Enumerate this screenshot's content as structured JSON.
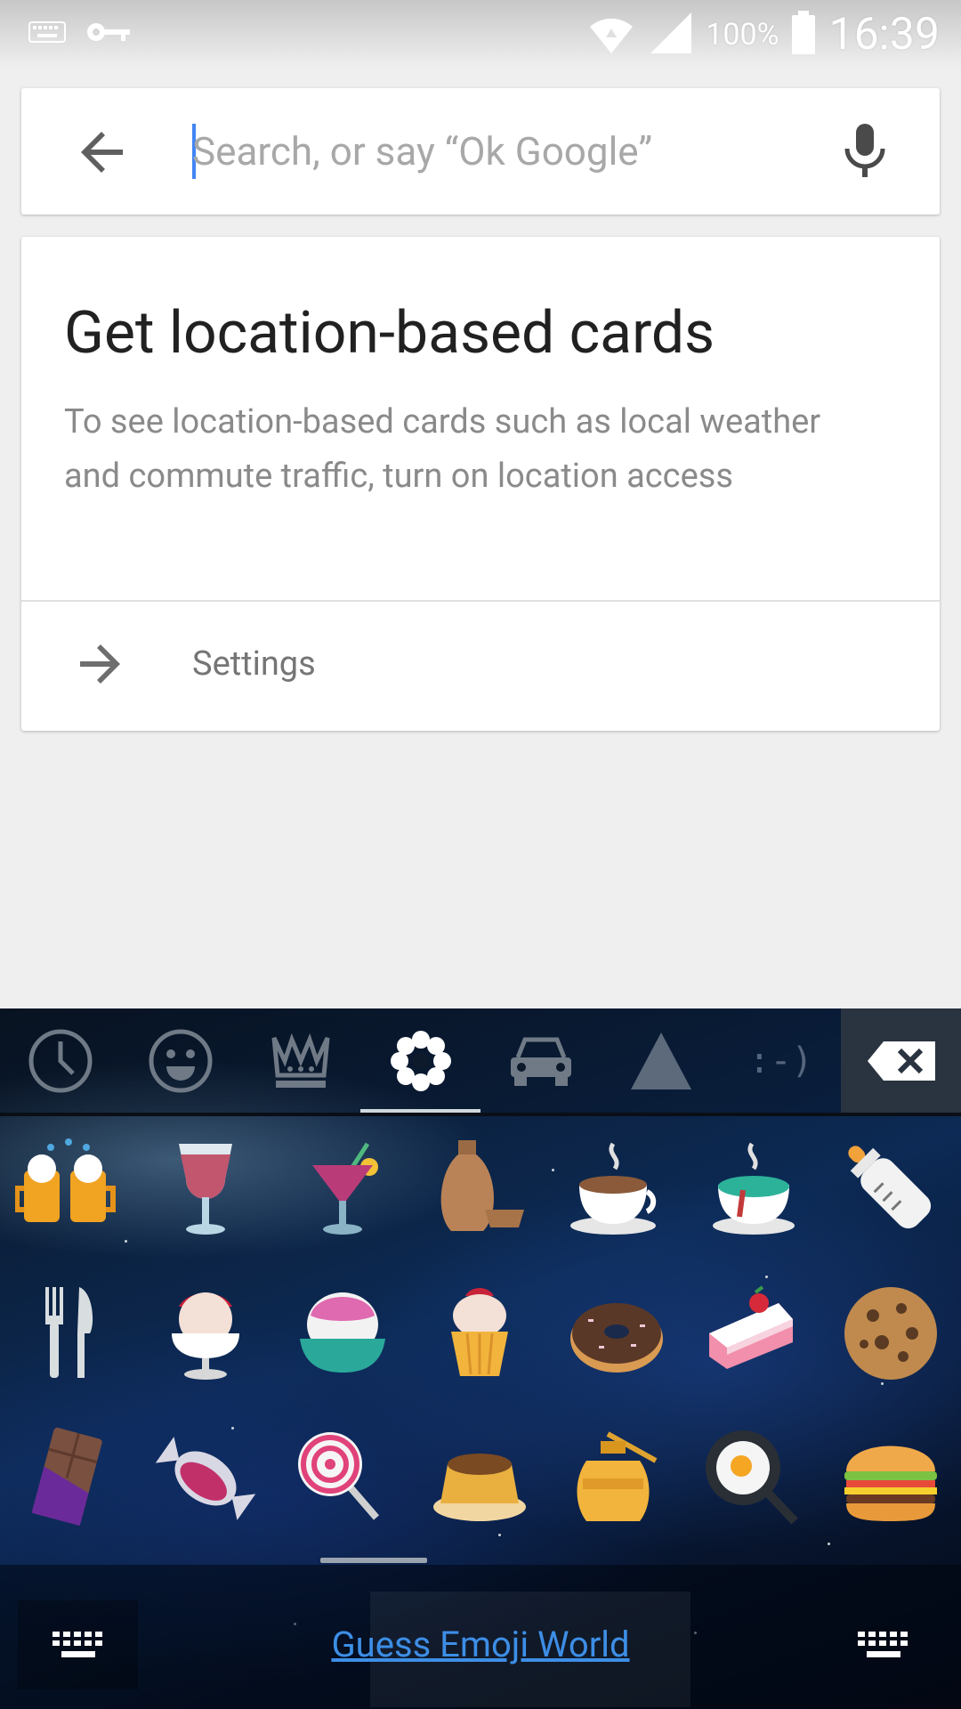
{
  "status_bar": {
    "battery": "100%",
    "time": "16:39"
  },
  "search": {
    "placeholder": "Search, or say “Ok Google”"
  },
  "card": {
    "title": "Get location-based cards",
    "body": "To see location-based cards such as local weather and commute traffic, turn on location access",
    "settings_label": "Settings"
  },
  "keyboard": {
    "emoticon_tab": ":-)",
    "promo": "Guess Emoji World",
    "active_tab": "nature",
    "emoji_rows": [
      [
        "beer-mugs",
        "wine-glass",
        "cocktail",
        "sake",
        "hot-coffee",
        "teapot",
        "baby-bottle"
      ],
      [
        "fork-knife",
        "ice-cream",
        "shaved-ice",
        "cupcake",
        "donut",
        "cake-slice",
        "cookie"
      ],
      [
        "chocolate-bar",
        "candy",
        "lollipop",
        "custard",
        "honey-pot",
        "fried-egg",
        "hamburger"
      ]
    ]
  }
}
